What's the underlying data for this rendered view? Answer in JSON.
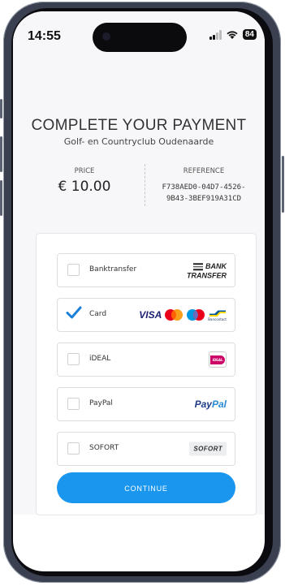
{
  "status_bar": {
    "time": "14:55",
    "battery": "84"
  },
  "header": {
    "title": "COMPLETE YOUR PAYMENT",
    "subtitle": "Golf- en Countryclub Oudenaarde"
  },
  "summary": {
    "price_label": "PRICE",
    "price_value": "€ 10.00",
    "reference_label": "REFERENCE",
    "reference_line1": "F738AED0-04D7-4526-",
    "reference_line2": "9B43-3BEF919A31CD"
  },
  "payment_methods": [
    {
      "label": "Banktransfer",
      "selected": false,
      "logo_text_1": "BANK",
      "logo_text_2": "TRANSFER"
    },
    {
      "label": "Card",
      "selected": true,
      "logo_text_1": "VISA",
      "logo_text_2": "Bancontact"
    },
    {
      "label": "iDEAL",
      "selected": false,
      "logo_text_1": "iDEAL"
    },
    {
      "label": "PayPal",
      "selected": false,
      "logo_text_1": "Pay",
      "logo_text_2": "Pal"
    },
    {
      "label": "SOFORT",
      "selected": false,
      "logo_text_1": "SOFORT"
    }
  ],
  "continue_label": "CONTINUE",
  "colors": {
    "accent": "#1a96ef",
    "check": "#1a7fd8"
  }
}
